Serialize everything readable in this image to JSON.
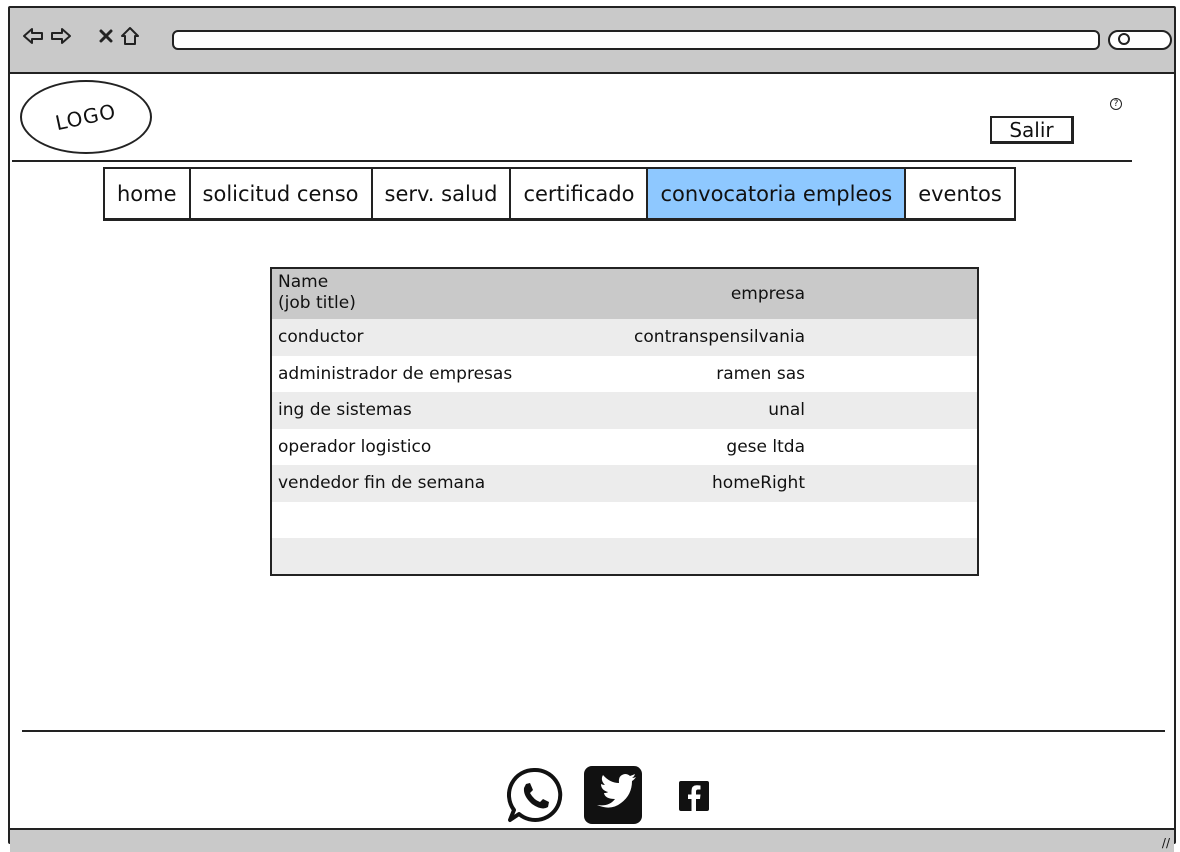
{
  "browser": {
    "nav_icons": [
      "back-arrow-icon",
      "forward-arrow-icon",
      "close-icon",
      "home-icon"
    ]
  },
  "header": {
    "logo_text": "LOGO",
    "logout_label": "Salir",
    "help_icon": "help-icon"
  },
  "tabs": [
    {
      "label": "home"
    },
    {
      "label": "solicitud censo"
    },
    {
      "label": "serv. salud"
    },
    {
      "label": "certificado"
    },
    {
      "label": "convocatoria empleos",
      "active": true
    },
    {
      "label": "eventos"
    }
  ],
  "jobs_table": {
    "columns": [
      "Name\n(job title)",
      "empresa"
    ],
    "rows": [
      [
        "conductor",
        "contranspensilvania"
      ],
      [
        "administrador de empresas",
        "ramen sas"
      ],
      [
        "ing de sistemas",
        "unal"
      ],
      [
        "operador logistico",
        "gese ltda"
      ],
      [
        "vendedor fin de semana",
        "homeRight"
      ],
      [
        "",
        ""
      ],
      [
        "",
        ""
      ]
    ]
  },
  "footer": {
    "social_icons": [
      "whatsapp-icon",
      "twitter-icon",
      "facebook-icon"
    ]
  },
  "colors": {
    "active_tab": "#8ec8ff",
    "table_header": "#c9c9c9",
    "row_alt": "#ececec"
  }
}
